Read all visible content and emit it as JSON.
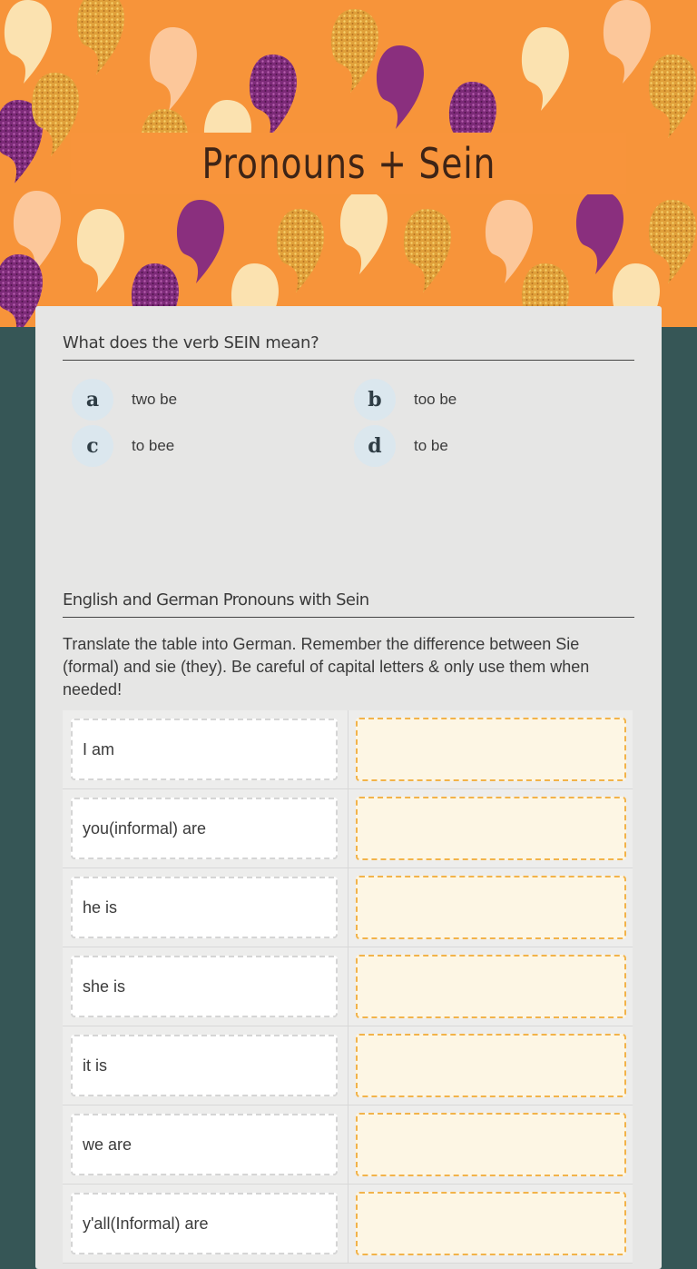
{
  "page": {
    "title": "Pronouns + Sein"
  },
  "question1": {
    "heading": "What does the verb SEIN mean?",
    "choices": [
      {
        "letter": "a",
        "text": "two be"
      },
      {
        "letter": "b",
        "text": "too be"
      },
      {
        "letter": "c",
        "text": "to bee"
      },
      {
        "letter": "d",
        "text": "to be"
      }
    ]
  },
  "question2": {
    "heading": "English and German Pronouns with Sein",
    "instructions": "Translate the table into German. Remember the difference between Sie (formal) and sie (they). Be careful of capital letters & only use them when needed!",
    "rows": [
      {
        "english": "I am",
        "answer": ""
      },
      {
        "english": "you(informal) are",
        "answer": ""
      },
      {
        "english": "he is",
        "answer": ""
      },
      {
        "english": "she is",
        "answer": ""
      },
      {
        "english": "it is",
        "answer": ""
      },
      {
        "english": "we are",
        "answer": ""
      },
      {
        "english": "y'all(Informal) are",
        "answer": ""
      }
    ]
  },
  "colors": {
    "banner_orange": "#f7943a",
    "background_teal": "#365656",
    "answer_border": "#f2b34a",
    "ghost_purple": "#8a2f7e",
    "ghost_cream": "#fbe2b0",
    "glitter_gold": "#e5a53a"
  }
}
